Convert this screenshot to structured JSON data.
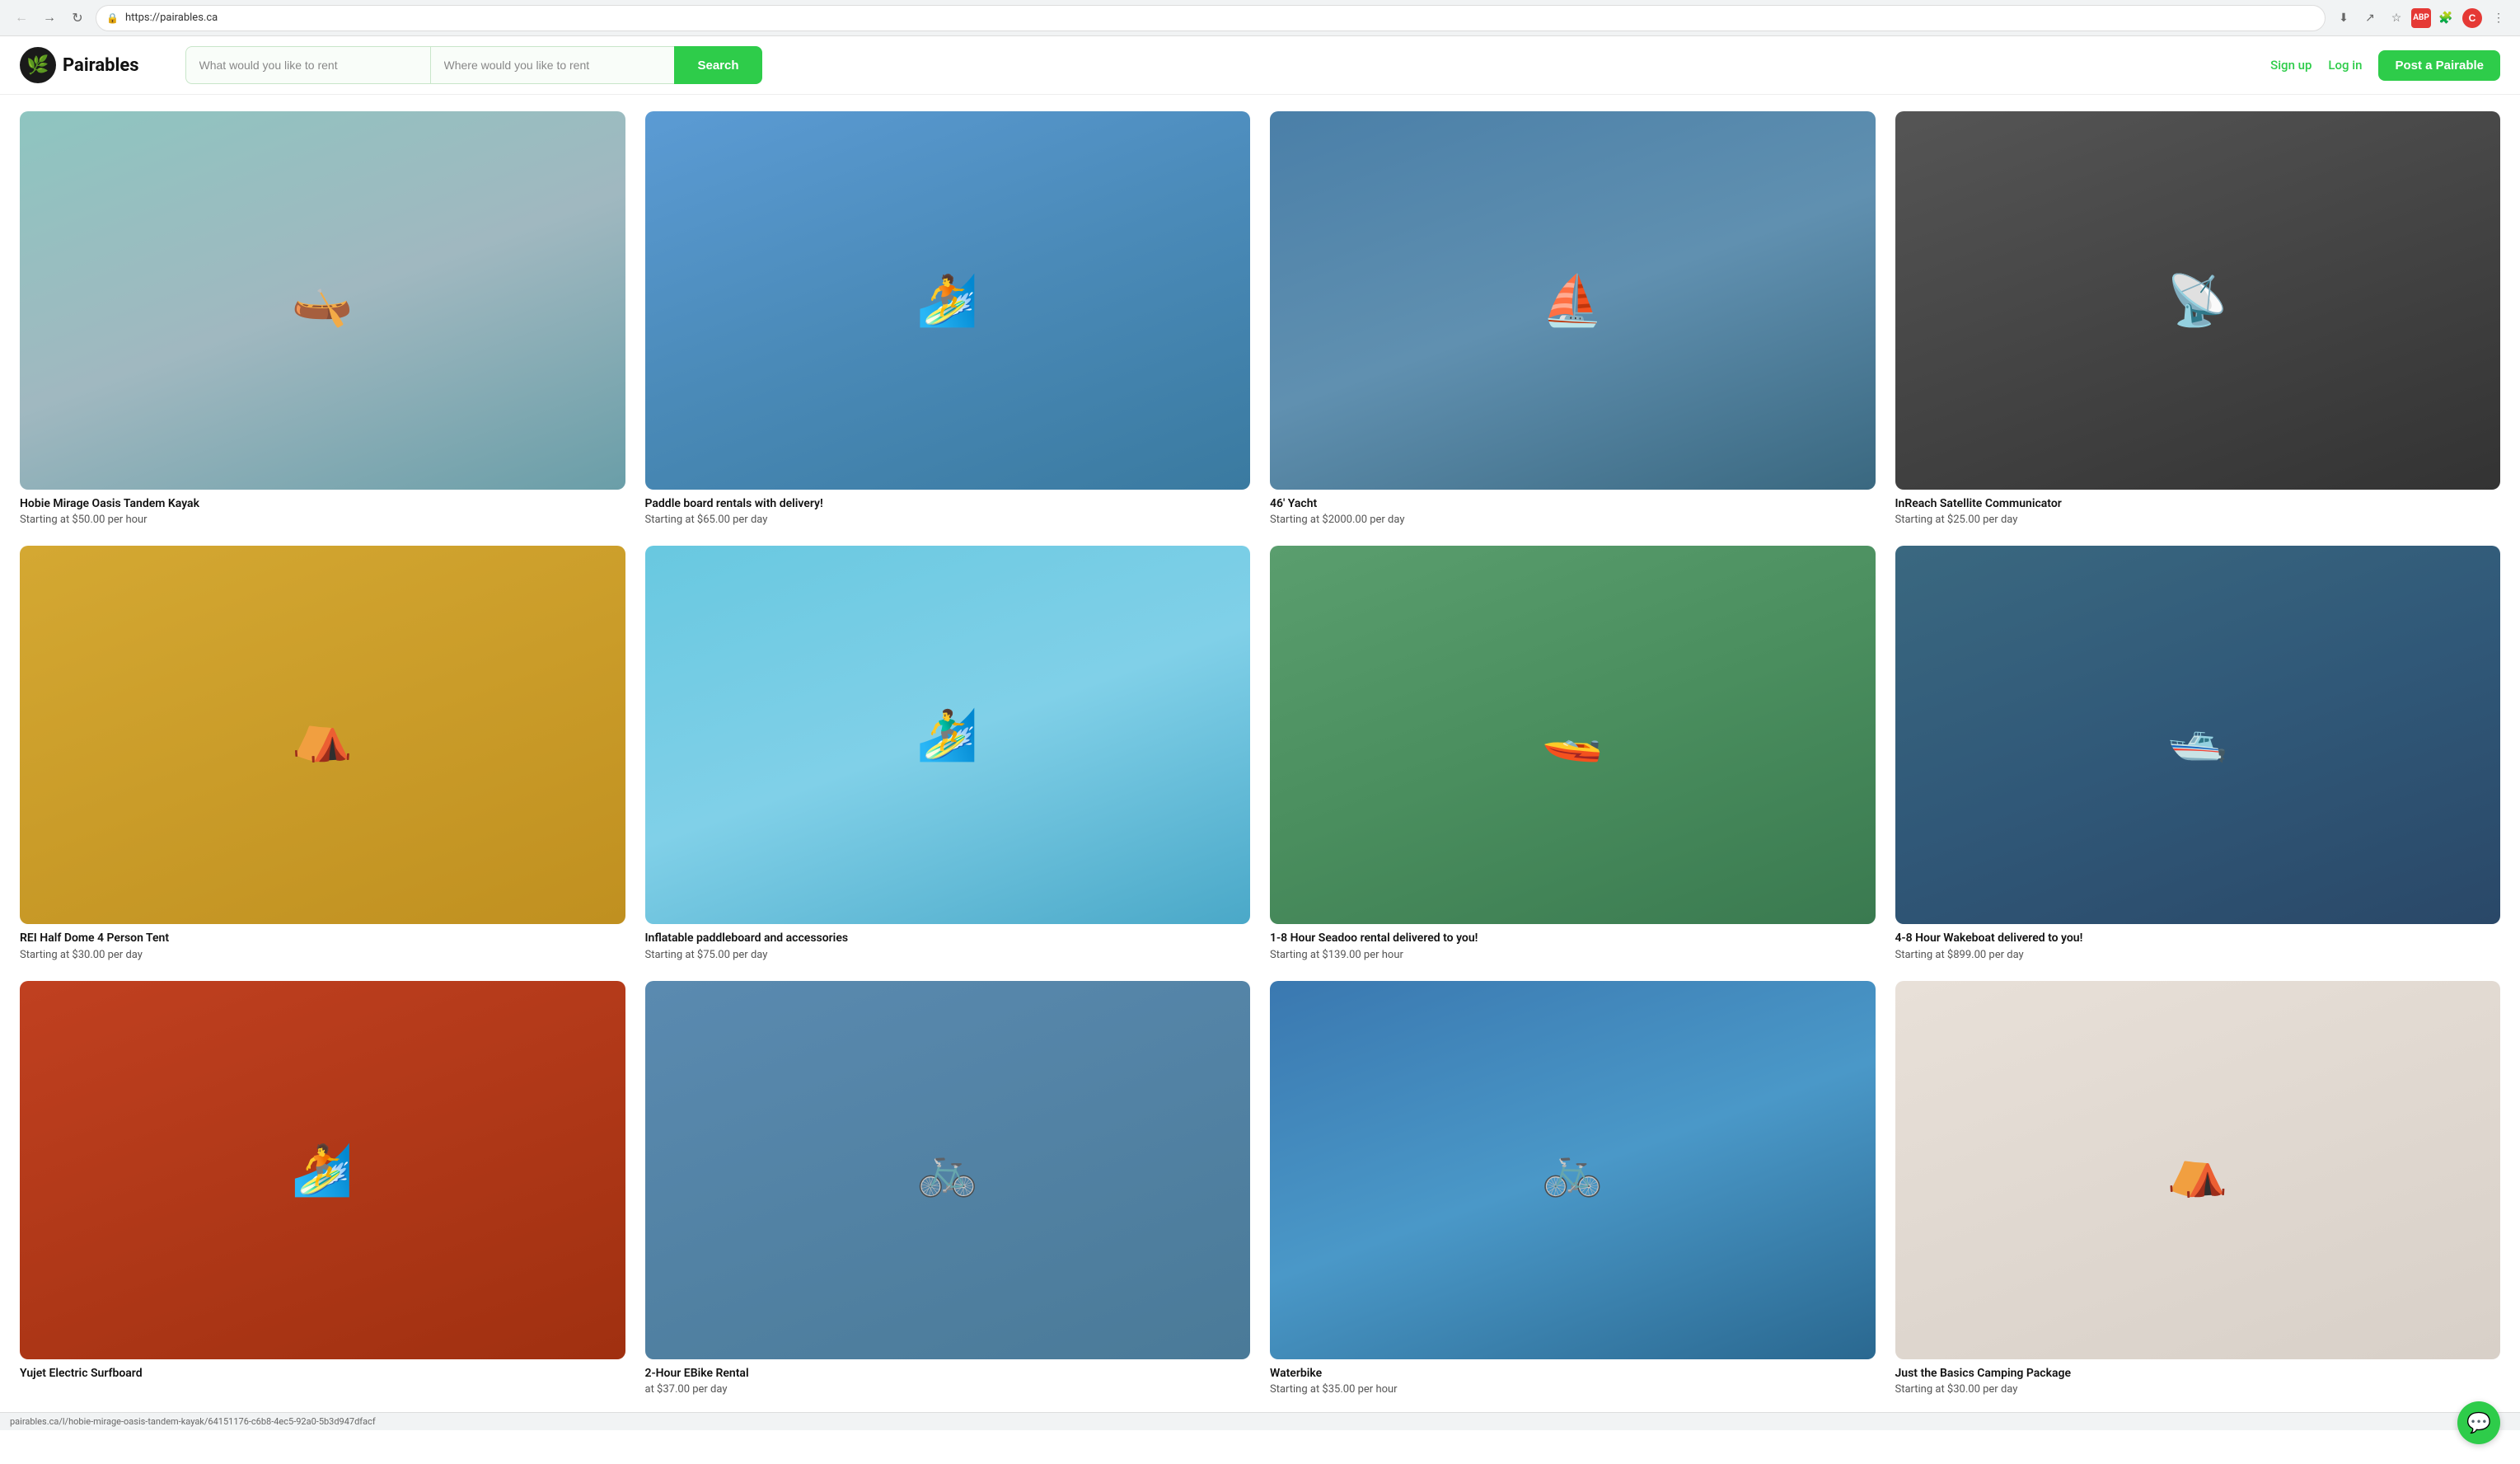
{
  "browser": {
    "url": "https://pairables.ca",
    "status_text": "pairables.ca/l/hobie-mirage-oasis-tandem-kayak/64151176-c6b8-4ec5-92a0-5b3d947dfacf"
  },
  "header": {
    "logo_text": "Pairables",
    "search_what_placeholder": "What would you like to rent",
    "search_where_placeholder": "Where would you like to rent",
    "search_btn_label": "Search",
    "signup_label": "Sign up",
    "login_label": "Log in",
    "post_label": "Post a Pairable"
  },
  "cards": [
    {
      "id": 1,
      "title": "Hobie Mirage Oasis Tandem Kayak",
      "price": "Starting at $50.00 per hour",
      "color": "#7ab8c0",
      "emoji": "🛶"
    },
    {
      "id": 2,
      "title": "Paddle board rentals with delivery!",
      "price": "Starting at $65.00 per day",
      "color": "#5b9bd4",
      "emoji": "🏄"
    },
    {
      "id": 3,
      "title": "46' Yacht",
      "price": "Starting at $2000.00 per day",
      "color": "#4a7fa8",
      "emoji": "⛵"
    },
    {
      "id": 4,
      "title": "InReach Satellite Communicator",
      "price": "Starting at $25.00 per day",
      "color": "#333",
      "emoji": "📡"
    },
    {
      "id": 5,
      "title": "REI Half Dome 4 Person Tent",
      "price": "Starting at $30.00 per day",
      "color": "#d4a832",
      "emoji": "⛺"
    },
    {
      "id": 6,
      "title": "Inflatable paddleboard and accessories",
      "price": "Starting at $75.00 per day",
      "color": "#68b4cc",
      "emoji": "🏄‍♂️"
    },
    {
      "id": 7,
      "title": "1-8 Hour Seadoo rental delivered to you!",
      "price": "Starting at $139.00 per hour",
      "color": "#5a9e6e",
      "emoji": "🚤"
    },
    {
      "id": 8,
      "title": "4-8 Hour Wakeboat delivered to you!",
      "price": "Starting at $899.00 per day",
      "color": "#3a7ab8",
      "emoji": "🛥️"
    },
    {
      "id": 9,
      "title": "Yujet Electric Surfboard",
      "price": "",
      "color": "#c04020",
      "emoji": "🏄"
    },
    {
      "id": 10,
      "title": "2-Hour EBike Rental",
      "price": "at $37.00 per day",
      "color": "#5a8ab0",
      "emoji": "🚲"
    },
    {
      "id": 11,
      "title": "Waterbike",
      "price": "Starting at $35.00 per hour",
      "color": "#3a78b0",
      "emoji": "🚲"
    },
    {
      "id": 12,
      "title": "Just the Basics Camping Package",
      "price": "Starting at $30.00 per day",
      "color": "#e8e0d8",
      "emoji": "⛺"
    }
  ]
}
